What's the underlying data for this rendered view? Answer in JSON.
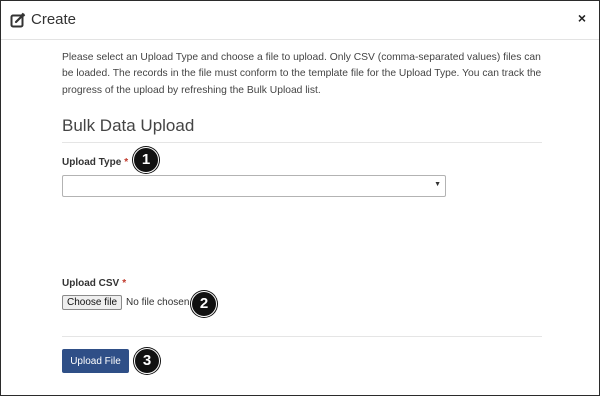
{
  "dialog": {
    "title": "Create",
    "header_icon": "edit-icon",
    "close_icon": "close-icon",
    "close_glyph": "×"
  },
  "intro_text": "Please select an Upload Type and choose a file to upload. Only CSV (comma-separated values) files can be loaded. The records in the file must conform to the template file for the Upload Type. You can track the progress of the upload by refreshing the Bulk Upload list.",
  "section_title": "Bulk Data Upload",
  "upload_type": {
    "label": "Upload Type",
    "required_mark": "*",
    "selected_value": ""
  },
  "upload_csv": {
    "label": "Upload CSV",
    "required_mark": "*",
    "choose_button_label": "Choose file",
    "file_status": "No file chosen"
  },
  "upload_button_label": "Upload File",
  "callouts": [
    "1",
    "2",
    "3"
  ],
  "colors": {
    "primary_button": "#2f4f87",
    "required": "#c0392b",
    "callout": "#111111"
  }
}
